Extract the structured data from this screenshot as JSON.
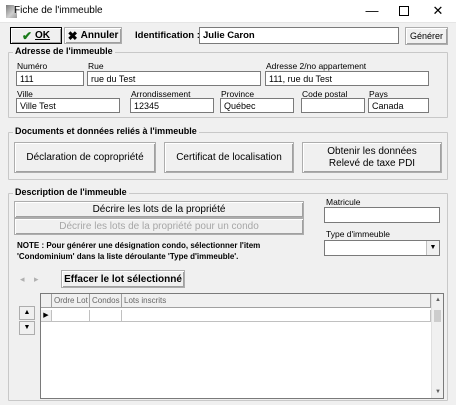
{
  "window": {
    "title": "Fiche de l'immeuble",
    "minimize": "—",
    "close": "✕"
  },
  "toolbar": {
    "ok_label": "OK",
    "cancel_label": "Annuler",
    "identification_label": "Identification :",
    "identification_value": "Julie Caron",
    "generate_label": "Générer"
  },
  "address": {
    "section_title": "Adresse de l'immeuble",
    "numero_label": "Numéro",
    "numero_value": "111",
    "rue_label": "Rue",
    "rue_value": "rue du Test",
    "adresse2_label": "Adresse 2/no appartement",
    "adresse2_value": "111, rue du Test",
    "ville_label": "Ville",
    "ville_value": "Ville Test",
    "arrondissement_label": "Arrondissement",
    "arrondissement_value": "12345",
    "province_label": "Province",
    "province_value": "Québec",
    "code_postal_label": "Code postal",
    "code_postal_value": "",
    "pays_label": "Pays",
    "pays_value": "Canada"
  },
  "documents": {
    "section_title": "Documents et données reliés à l'immeuble",
    "declaration_label": "Déclaration de copropriété",
    "certificat_label": "Certificat de localisation",
    "taxe_line1": "Obtenir les données",
    "taxe_line2": "Relevé de taxe PDI"
  },
  "description": {
    "section_title": "Description de l'immeuble",
    "decrire_lots_label": "Décrire les lots de la propriété",
    "decrire_condo_label": "Décrire les lots de la propriété pour un condo",
    "note_text": "NOTE : Pour générer une désignation condo, sélectionner l'item 'Condominium' dans la liste déroulante 'Type d'immeuble'.",
    "matricule_label": "Matricule",
    "matricule_value": "",
    "type_label": "Type d'immeuble",
    "type_value": "",
    "effacer_label": "Effacer le lot sélectionné",
    "grid_columns": [
      "Ordre Lot",
      "Condos",
      "Lots inscrits"
    ]
  },
  "colors": {
    "window_bg": "#f0f0f0",
    "check_green": "#1a7a1a"
  }
}
